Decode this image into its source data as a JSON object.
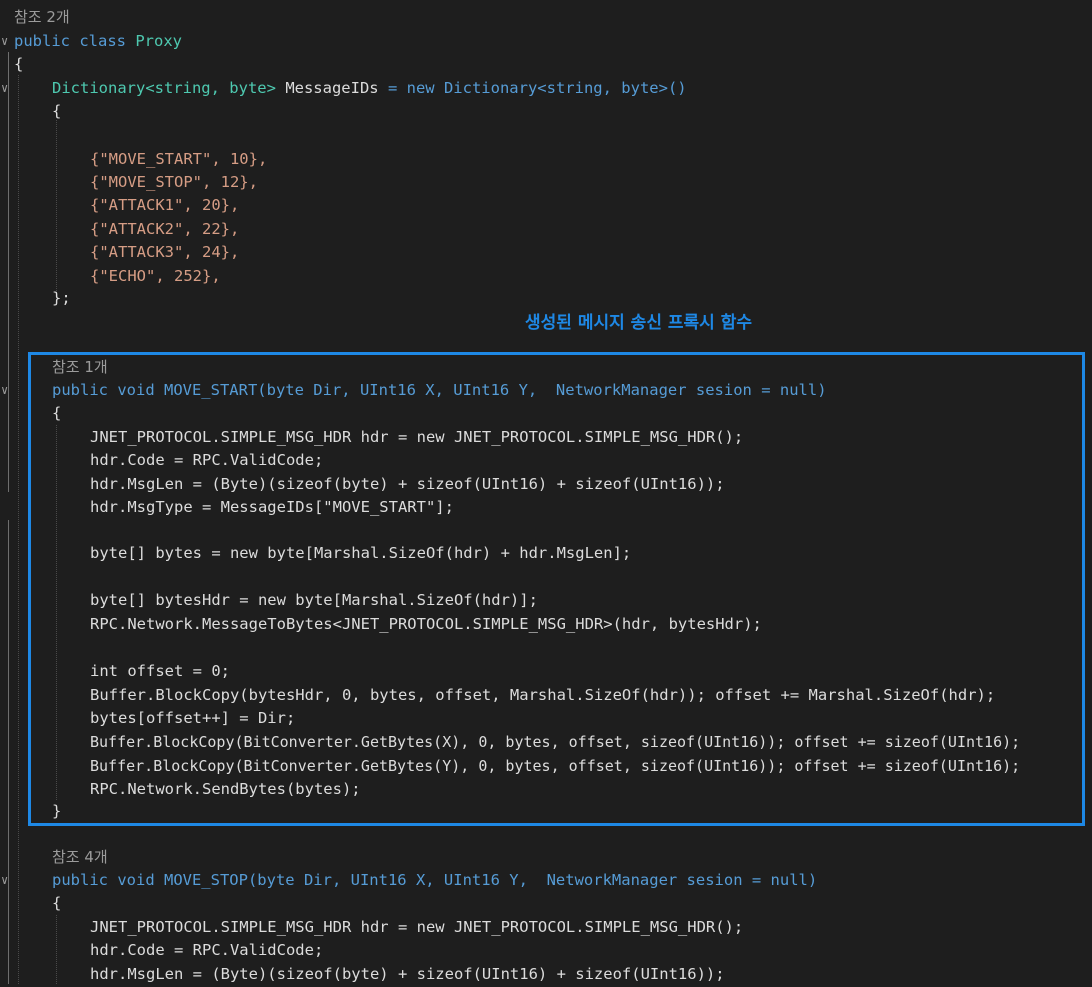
{
  "lines": {
    "ref_class": "참조 2개",
    "class_kw": "public class",
    "class_name": "Proxy",
    "brace_open": "{",
    "dict_type": "Dictionary<string, byte>",
    "dict_name": "MessageIDs",
    "dict_init": "= new Dictionary<string, byte>()",
    "dict_brace_open": "{",
    "entries": [
      "{\"MOVE_START\", 10},",
      "{\"MOVE_STOP\", 12},",
      "{\"ATTACK1\", 20},",
      "{\"ATTACK2\", 22},",
      "{\"ATTACK3\", 24},",
      "{\"ECHO\", 252},"
    ],
    "dict_brace_close": "};",
    "caption": "생성된 메시지 송신 프록시 함수",
    "ref_move_start": "참조 1개",
    "sig_move_start": "public void MOVE_START(byte Dir, UInt16 X, UInt16 Y,  NetworkManager sesion = null)",
    "body1_open": "{",
    "body1": [
      "JNET_PROTOCOL.SIMPLE_MSG_HDR hdr = new JNET_PROTOCOL.SIMPLE_MSG_HDR();",
      "hdr.Code = RPC.ValidCode;",
      "hdr.MsgLen = (Byte)(sizeof(byte) + sizeof(UInt16) + sizeof(UInt16));",
      "hdr.MsgType = MessageIDs[\"MOVE_START\"];",
      "",
      "byte[] bytes = new byte[Marshal.SizeOf(hdr) + hdr.MsgLen];",
      "",
      "byte[] bytesHdr = new byte[Marshal.SizeOf(hdr)];",
      "RPC.Network.MessageToBytes<JNET_PROTOCOL.SIMPLE_MSG_HDR>(hdr, bytesHdr);",
      "",
      "int offset = 0;",
      "Buffer.BlockCopy(bytesHdr, 0, bytes, offset, Marshal.SizeOf(hdr)); offset += Marshal.SizeOf(hdr);",
      "bytes[offset++] = Dir;",
      "Buffer.BlockCopy(BitConverter.GetBytes(X), 0, bytes, offset, sizeof(UInt16)); offset += sizeof(UInt16);",
      "Buffer.BlockCopy(BitConverter.GetBytes(Y), 0, bytes, offset, sizeof(UInt16)); offset += sizeof(UInt16);",
      "RPC.Network.SendBytes(bytes);"
    ],
    "body1_close": "}",
    "ref_move_stop": "참조 4개",
    "sig_move_stop": "public void MOVE_STOP(byte Dir, UInt16 X, UInt16 Y,  NetworkManager sesion = null)",
    "body2_open": "{",
    "body2": [
      "JNET_PROTOCOL.SIMPLE_MSG_HDR hdr = new JNET_PROTOCOL.SIMPLE_MSG_HDR();",
      "hdr.Code = RPC.ValidCode;",
      "hdr.MsgLen = (Byte)(sizeof(byte) + sizeof(UInt16) + sizeof(UInt16));"
    ]
  },
  "colors": {
    "background": "#1e1e1e",
    "highlight_box": "#1e88e5",
    "caption": "#1e88e5",
    "keyword": "#569cd6",
    "type": "#4ec9b0",
    "string": "#d69d85",
    "number": "#b5cea8"
  },
  "icons": [
    "fold-chevron-icon"
  ]
}
